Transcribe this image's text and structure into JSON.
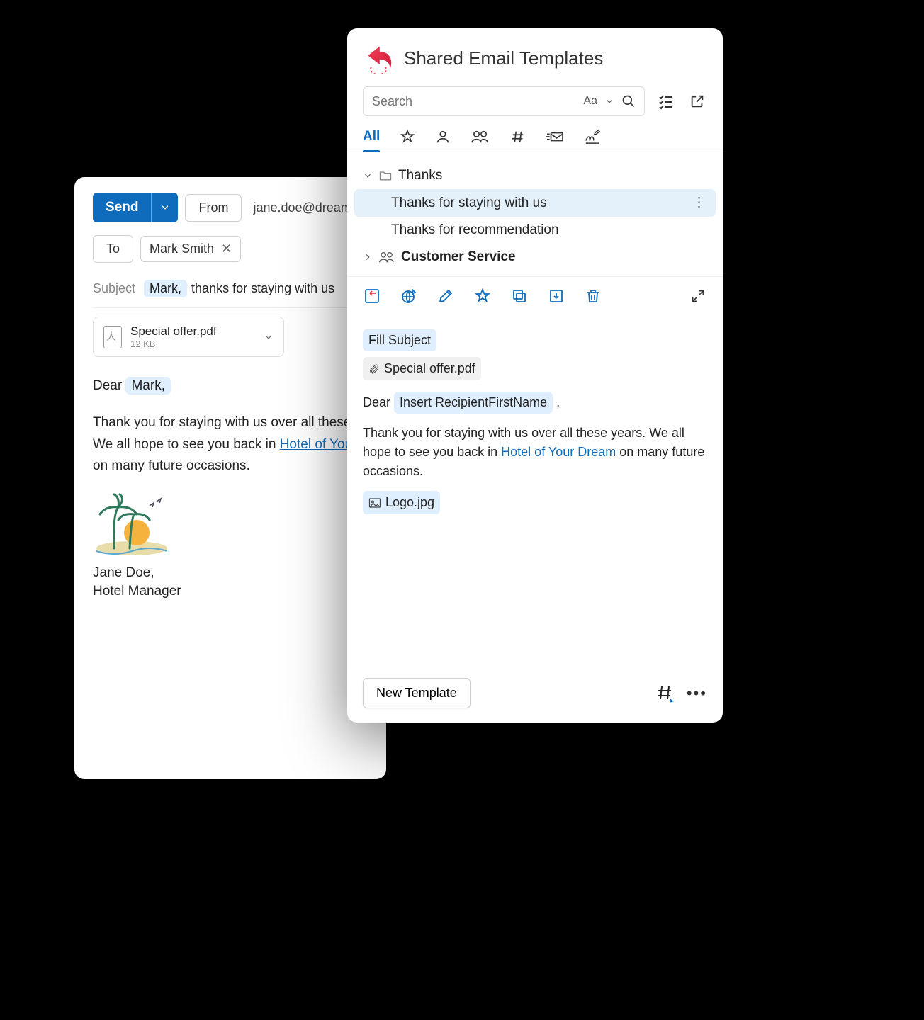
{
  "compose": {
    "send_label": "Send",
    "from_button": "From",
    "from_email": "jane.doe@dream",
    "to_button": "To",
    "recipient": "Mark Smith",
    "subject_label": "Subject",
    "subject_highlight": "Mark,",
    "subject_rest": "thanks for staying with us",
    "attachment": {
      "name": "Special offer.pdf",
      "size": "12 KB"
    },
    "greeting_prefix": "Dear",
    "greeting_highlight": "Mark,",
    "body_line1": "Thank you for staying with us over all these",
    "body_line2_prefix": "We all hope to see you back in",
    "body_link": "Hotel of You",
    "body_line3": "on many future occasions.",
    "signature_name": "Jane Doe,",
    "signature_title": "Hotel Manager"
  },
  "templates": {
    "title": "Shared Email Templates",
    "search_placeholder": "Search",
    "font_label": "Aa",
    "tabs": {
      "all": "All"
    },
    "tree": {
      "folder1": "Thanks",
      "item1": "Thanks for staying with us",
      "item2": "Thanks for recommendation",
      "folder2": "Customer Service"
    },
    "preview": {
      "fill_subject": "Fill Subject",
      "attachment": "Special offer.pdf",
      "greeting_prefix": "Dear",
      "greeting_token": "Insert RecipientFirstName",
      "greeting_suffix": ",",
      "para1a": "Thank you for staying with us over all these years.",
      "para1b_prefix": "We all hope to see you back in",
      "para1b_link": "Hotel of Your Dream",
      "para1b_suffix": "on many future occasions.",
      "logo": "Logo.jpg"
    },
    "new_template": "New Template"
  }
}
